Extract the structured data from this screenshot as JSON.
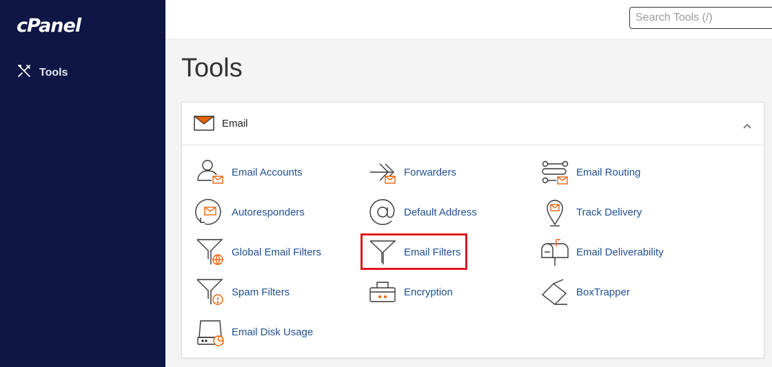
{
  "app": {
    "logo": "cPanel"
  },
  "sidebar": {
    "items": [
      {
        "label": "Tools",
        "icon": "tools-icon"
      }
    ]
  },
  "search": {
    "placeholder": "Search Tools (/)",
    "value": ""
  },
  "page": {
    "title": "Tools"
  },
  "section": {
    "title": "Email",
    "icon": "envelope-icon",
    "tools": [
      {
        "label": "Email Accounts",
        "icon": "email-accounts-icon"
      },
      {
        "label": "Forwarders",
        "icon": "forwarders-icon"
      },
      {
        "label": "Email Routing",
        "icon": "email-routing-icon"
      },
      {
        "label": "Autoresponders",
        "icon": "autoresponders-icon"
      },
      {
        "label": "Default Address",
        "icon": "at-sign-icon"
      },
      {
        "label": "Track Delivery",
        "icon": "location-pin-icon"
      },
      {
        "label": "Global Email Filters",
        "icon": "global-filter-icon"
      },
      {
        "label": "Email Filters",
        "icon": "filter-icon"
      },
      {
        "label": "Email Deliverability",
        "icon": "mailbox-icon"
      },
      {
        "label": "Spam Filters",
        "icon": "spam-filter-icon"
      },
      {
        "label": "Encryption",
        "icon": "encryption-icon"
      },
      {
        "label": "BoxTrapper",
        "icon": "boxtrapper-icon"
      },
      {
        "label": "Email Disk Usage",
        "icon": "disk-usage-icon"
      }
    ]
  },
  "colors": {
    "sidebar": "#0d1645",
    "accent": "#e8630a",
    "link": "#1f4f8f",
    "highlight": "#e0141e"
  }
}
